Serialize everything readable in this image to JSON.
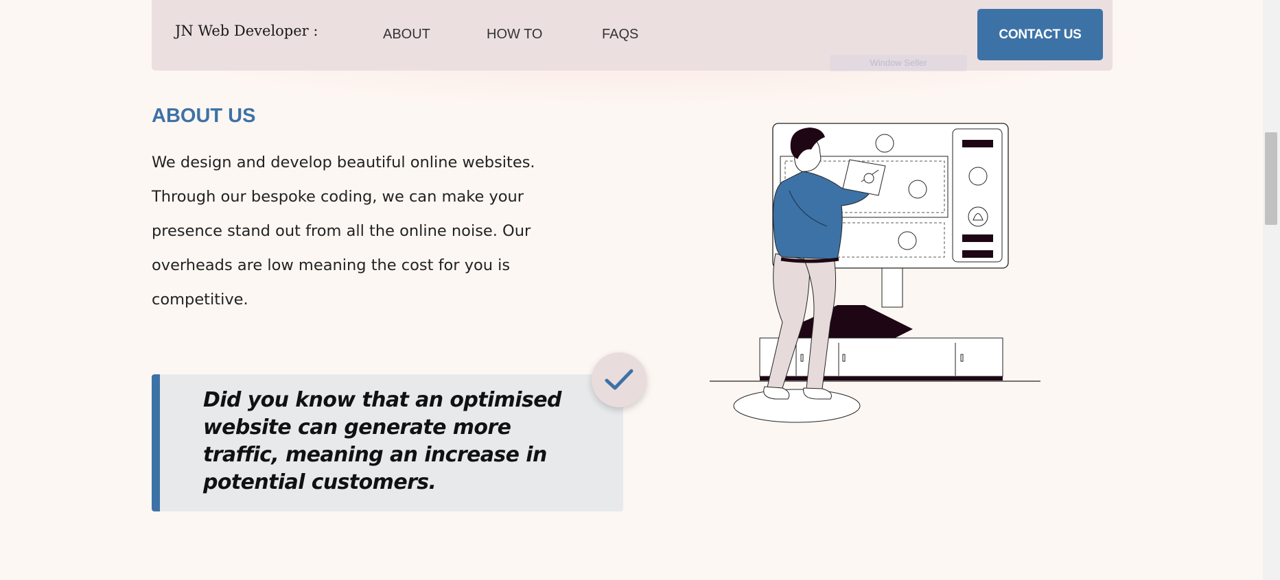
{
  "nav": {
    "brand": "JN Web Developer :",
    "links": [
      "ABOUT",
      "HOW TO",
      "FAQS"
    ],
    "ghost_label": "Window Seller",
    "cta": "CONTACT US"
  },
  "about": {
    "title": "ABOUT US",
    "body": "We design and develop beautiful online websites. Through our bespoke coding, we can make your presence stand out from all the online noise. Our overheads are low meaning the cost for you is competitive."
  },
  "callout": {
    "text": "Did you know that an optimised website can generate more traffic, meaning an increase in potential customers."
  },
  "icons": {
    "check": "checkmark-icon",
    "illustration": "developer-at-board-illustration"
  },
  "colors": {
    "accent": "#3d72a6",
    "background": "#fdf7f3",
    "navbar": "#ecdfe0",
    "callout_bg": "#e8e9eb",
    "dark": "#1e0614"
  }
}
